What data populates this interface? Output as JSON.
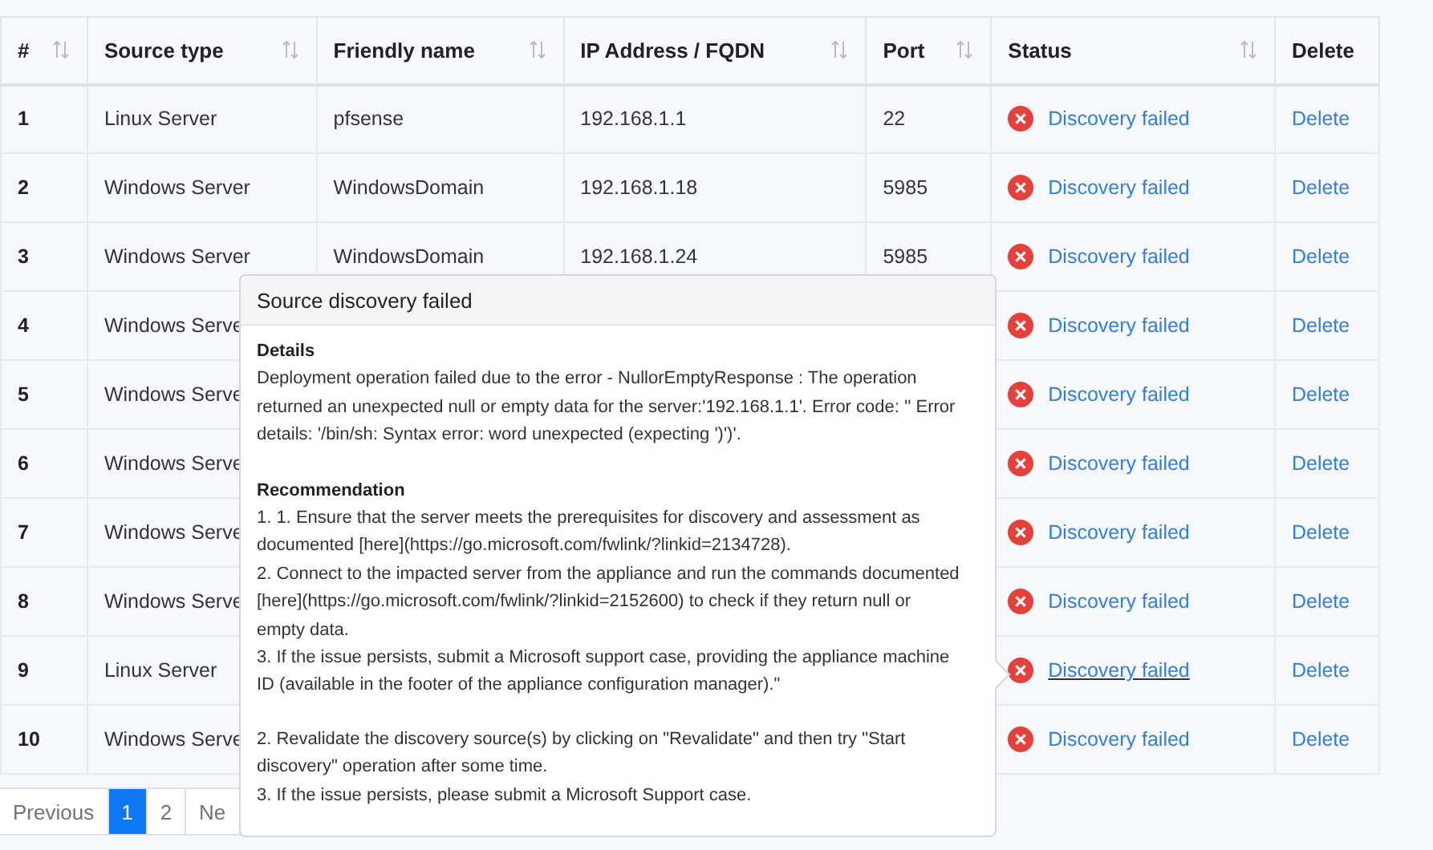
{
  "table": {
    "columns": [
      {
        "label": "#",
        "sortable": true
      },
      {
        "label": "Source type",
        "sortable": true
      },
      {
        "label": "Friendly name",
        "sortable": true
      },
      {
        "label": "IP Address / FQDN",
        "sortable": true
      },
      {
        "label": "Port",
        "sortable": true
      },
      {
        "label": "Status",
        "sortable": true
      },
      {
        "label": "Delete",
        "sortable": false
      }
    ],
    "rows": [
      {
        "number": "1",
        "source_type": "Linux Server",
        "friendly_name": "pfsense",
        "ip": "192.168.1.1",
        "port": "22",
        "status": "Discovery failed",
        "hovered": false,
        "delete": "Delete"
      },
      {
        "number": "2",
        "source_type": "Windows Server",
        "friendly_name": "WindowsDomain",
        "ip": "192.168.1.18",
        "port": "5985",
        "status": "Discovery failed",
        "hovered": false,
        "delete": "Delete"
      },
      {
        "number": "3",
        "source_type": "Windows Server",
        "friendly_name": "WindowsDomain",
        "ip": "192.168.1.24",
        "port": "5985",
        "status": "Discovery failed",
        "hovered": false,
        "delete": "Delete"
      },
      {
        "number": "4",
        "source_type": "Windows Serve",
        "status": "Discovery failed",
        "hovered": false,
        "delete": "Delete"
      },
      {
        "number": "5",
        "source_type": "Windows Serve",
        "status": "Discovery failed",
        "hovered": false,
        "delete": "Delete"
      },
      {
        "number": "6",
        "source_type": "Windows Serve",
        "status": "Discovery failed",
        "hovered": false,
        "delete": "Delete"
      },
      {
        "number": "7",
        "source_type": "Windows Serve",
        "status": "Discovery failed",
        "hovered": false,
        "delete": "Delete"
      },
      {
        "number": "8",
        "source_type": "Windows Serve",
        "status": "Discovery failed",
        "hovered": false,
        "delete": "Delete"
      },
      {
        "number": "9",
        "source_type": "Linux Server",
        "status": "Discovery failed",
        "hovered": true,
        "delete": "Delete"
      },
      {
        "number": "10",
        "source_type": "Windows Serve",
        "status": "Discovery failed",
        "hovered": false,
        "delete": "Delete"
      }
    ]
  },
  "pagination": [
    {
      "label": "Previous",
      "selected": false
    },
    {
      "label": "1",
      "selected": true
    },
    {
      "label": "2",
      "selected": false
    },
    {
      "label": "Ne",
      "selected": false
    }
  ],
  "popover": {
    "title": "Source discovery failed",
    "details_heading": "Details",
    "details": "Deployment operation failed due to the error - NullorEmptyResponse : The operation returned an unexpected null or empty data for the server:'192.168.1.1'. Error code: '' Error details: '/bin/sh: Syntax error: word unexpected (expecting ')')'.",
    "recommendation_heading": "Recommendation",
    "recommendation_blocks": [
      [
        "1. 1. Ensure that the server meets the prerequisites for discovery and assessment as documented [here](https://go.microsoft.com/fwlink/?linkid=2134728).",
        "2. Connect to the impacted server from the appliance and run the commands documented [here](https://go.microsoft.com/fwlink/?linkid=2152600) to check if they return null or empty data.",
        "3. If the issue persists, submit a Microsoft support case, providing the appliance machine ID (available in the footer of the appliance configuration manager).\""
      ],
      [
        "2. Revalidate the discovery source(s) by clicking on \"Revalidate\" and then try \"Start discovery\" operation after some time.",
        "3. If the issue persists, please submit a Microsoft Support case."
      ]
    ]
  }
}
